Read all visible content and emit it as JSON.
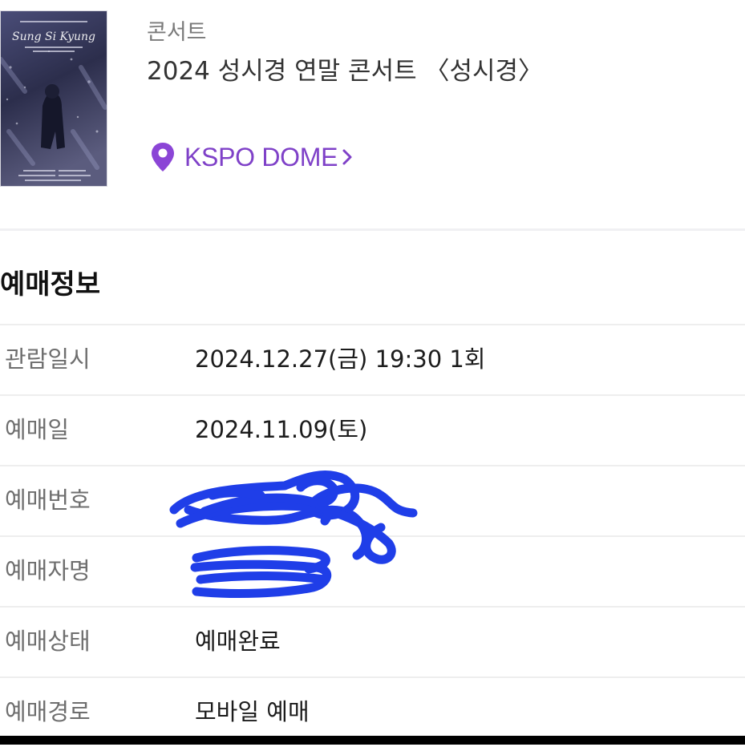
{
  "event": {
    "category": "콘서트",
    "title": "2024 성시경 연말 콘서트 〈성시경〉",
    "venue": "KSPO DOME",
    "poster_icon": "concert-poster-image"
  },
  "booking": {
    "section_title": "예매정보",
    "rows": [
      {
        "label": "관람일시",
        "value": "2024.12.27(금) 19:30 1회"
      },
      {
        "label": "예매일",
        "value": "2024.11.09(토)"
      },
      {
        "label": "예매번호",
        "value": ""
      },
      {
        "label": "예매자명",
        "value": ""
      },
      {
        "label": "예매상태",
        "value": "예매완료"
      },
      {
        "label": "예매경로",
        "value": "모바일 예매"
      }
    ]
  },
  "icons": {
    "venue": "map-pin-icon",
    "venue_arrow": "chevron-right-icon"
  },
  "colors": {
    "accent": "#7f41c8",
    "redaction": "#1f3ee8",
    "label": "#6e6e6e",
    "divider": "#eeeeee"
  }
}
